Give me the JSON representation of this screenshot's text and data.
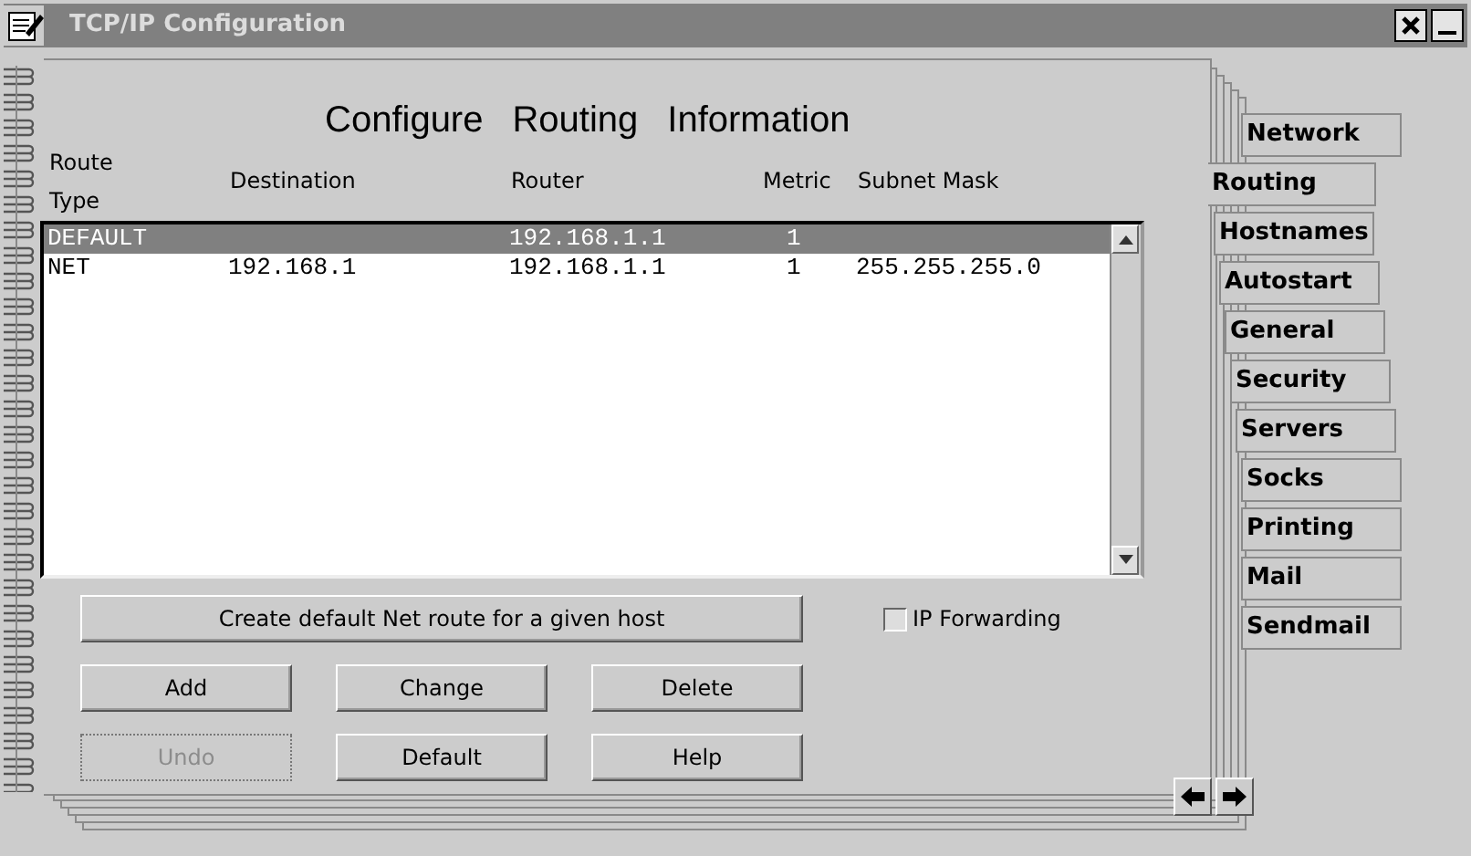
{
  "window": {
    "title": "TCP/IP Configuration"
  },
  "heading": [
    "Configure",
    "Routing",
    "Information"
  ],
  "columns": [
    "Route\nType",
    "Destination",
    "Router",
    "Metric",
    "Subnet Mask"
  ],
  "routes": [
    {
      "type": "DEFAULT",
      "router": "192.168.1.1",
      "metric": "1",
      "selected": true
    },
    {
      "type": "NET",
      "destination": "192.168.1",
      "router": "192.168.1.1",
      "metric": "1",
      "subnet_mask": "255.255.255.0",
      "selected": false
    }
  ],
  "create_button": {
    "label": "Create default Net route for a given host"
  },
  "ip_forwarding": {
    "label": "IP Forwarding",
    "checked": false
  },
  "buttons": [
    {
      "label": "Add",
      "disabled": false
    },
    {
      "label": "Change",
      "disabled": false
    },
    {
      "label": "Delete",
      "disabled": false
    },
    {
      "label": "Undo",
      "disabled": true
    },
    {
      "label": "Default",
      "disabled": false
    },
    {
      "label": "Help",
      "disabled": false
    }
  ],
  "tabs": [
    {
      "label": "Network",
      "selected": false
    },
    {
      "label": "Routing",
      "selected": true
    },
    {
      "label": "Hostnames",
      "selected": false
    },
    {
      "label": "Autostart",
      "selected": false
    },
    {
      "label": "General",
      "selected": false
    },
    {
      "label": "Security",
      "selected": false
    },
    {
      "label": "Servers",
      "selected": false
    },
    {
      "label": "Socks",
      "selected": false
    },
    {
      "label": "Printing",
      "selected": false
    },
    {
      "label": "Mail",
      "selected": false
    },
    {
      "label": "Sendmail",
      "selected": false
    }
  ]
}
